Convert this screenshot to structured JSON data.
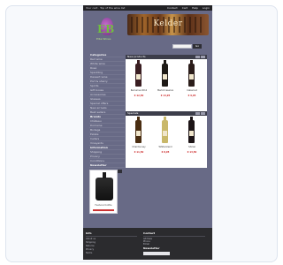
{
  "topbar": {
    "left_text": "Your cart · Top of the wine list",
    "nav": [
      "Contact",
      "Cart",
      "Help",
      "Login"
    ]
  },
  "header": {
    "logo_letters": "EB",
    "logo_name": "Elba Wines",
    "banner_title": "Kelder"
  },
  "search": {
    "placeholder": "",
    "button": "Go"
  },
  "sidebar": {
    "items": [
      {
        "label": "Categories",
        "head": true
      },
      {
        "label": "Red wine"
      },
      {
        "label": "White wine"
      },
      {
        "label": "Rosé"
      },
      {
        "label": "Sparkling"
      },
      {
        "label": "Dessert wine"
      },
      {
        "label": "Port & sherry"
      },
      {
        "label": "Spirits"
      },
      {
        "label": "Gift boxes"
      },
      {
        "label": "Accessories"
      },
      {
        "label": "Glasses"
      },
      {
        "label": "Special offers"
      },
      {
        "label": "New arrivals"
      },
      {
        "label": "Best sellers"
      },
      {
        "label": "Brands",
        "head": true
      },
      {
        "label": "Château"
      },
      {
        "label": "Domaine"
      },
      {
        "label": "Bodega"
      },
      {
        "label": "Estate"
      },
      {
        "label": "Cellars"
      },
      {
        "label": "Vineyards"
      },
      {
        "label": "Information",
        "head": true
      },
      {
        "label": "Shipping"
      },
      {
        "label": "Privacy"
      },
      {
        "label": "Conditions"
      },
      {
        "label": "Newsletter",
        "head": true
      }
    ]
  },
  "ad": {
    "caption": "Featured bottle"
  },
  "sections": [
    {
      "title": "New products"
    },
    {
      "title": "Specials"
    }
  ],
  "products": [
    {
      "name": "Red wine 2012",
      "price": "€ 12,50",
      "color": "#3a1e22"
    },
    {
      "name": "Merlot reserve",
      "price": "€ 14,95",
      "color": "#1e1a16"
    },
    {
      "name": "Cabernet",
      "price": "€ 9,95",
      "color": "#2b1d1a"
    },
    {
      "name": "Chardonnay",
      "price": "€ 11,50",
      "color": "#4a2e12"
    },
    {
      "name": "White blend",
      "price": "€ 8,95",
      "color": "#c9b86a"
    },
    {
      "name": "Shiraz",
      "price": "€ 13,50",
      "color": "#1c1416"
    }
  ],
  "footer": {
    "col1_title": "Info",
    "col2_title": "Contact",
    "col3_title": "Newsletter",
    "col1_links": [
      "About us",
      "Shipping",
      "Returns",
      "Privacy",
      "Terms"
    ],
    "col2_links": [
      "Address",
      "Phone",
      "Email"
    ]
  }
}
